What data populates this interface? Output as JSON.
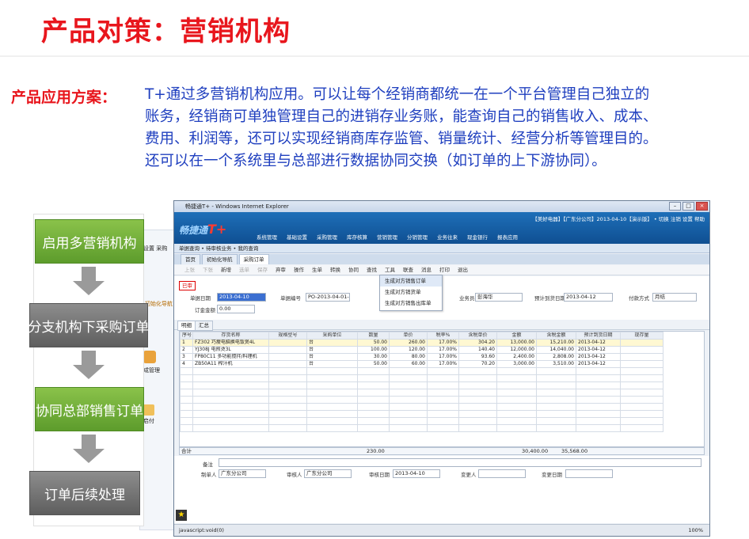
{
  "slide": {
    "title": "产品对策：营销机构",
    "solution_label": "产品应用方案：",
    "solution_lines": [
      "T+通过多营销机构应用。可以让每个经销商都统一在一个平台管理自己独立的",
      "账务，经销商可单独管理自己的进销存业务账，能查询自己的销售收入、成本、",
      "费用、利润等，还可以实现经销商库存监管、销量统计、经营分析等管理目的。",
      "还可以在一个系统里与总部进行数据协同交换（如订单的上下游协同）。"
    ]
  },
  "flow": {
    "steps": [
      "启用多营销机构",
      "分支机构下采购订单",
      "协同总部销售订单",
      "订单后续处理"
    ]
  },
  "bg_fragments": {
    "nav1": "成管理",
    "nav2": "启付",
    "nav3": "初始化导航",
    "nav4": "设置  采购"
  },
  "window": {
    "title": "畅捷通T+ - Windows Internet Explorer",
    "logo_text": "畅捷通",
    "logo_mark": "T+",
    "top_info": "【美好电器】【广东分公司】2013-04-10【演示版】 • 切换  注销  设置  帮助",
    "menu": [
      "系统管理",
      "基础设置",
      "采购管理",
      "库存核算",
      "营销管理",
      "分销管理",
      "业务往来",
      "现金银行",
      "报表应用"
    ],
    "subbar": "单据查询 • 待审核业务 • 我的查询",
    "tabs": [
      "首页",
      "初始化导航",
      "采购订单"
    ],
    "toolbar": [
      {
        "label": "上张",
        "disabled": true
      },
      {
        "label": "下张",
        "disabled": true
      },
      {
        "label": "新增",
        "disabled": false
      },
      {
        "label": "选单",
        "disabled": true
      },
      {
        "label": "保存",
        "disabled": true
      },
      {
        "label": "弃审",
        "disabled": false
      },
      {
        "label": "操作",
        "disabled": false
      },
      {
        "label": "生单",
        "disabled": false
      },
      {
        "label": "转换",
        "disabled": false
      },
      {
        "label": "协同",
        "disabled": false
      },
      {
        "label": "查找",
        "disabled": false
      },
      {
        "label": "工具",
        "disabled": false
      },
      {
        "label": "联查",
        "disabled": false
      },
      {
        "label": "消息",
        "disabled": false
      },
      {
        "label": "打印",
        "disabled": false
      },
      {
        "label": "退出",
        "disabled": false
      }
    ],
    "dropdown": [
      "生成对方销售订单",
      "生成对方销货单",
      "生成对方销售出库单"
    ],
    "form": {
      "stamp": "已审",
      "date_label": "单据日期",
      "date_value": "2013-04-10",
      "code_label": "单据编号",
      "code_value": "PO-2013-04-01-00…",
      "salesman_label": "业务员",
      "salesman_value": "彭海华",
      "arrival_label": "预计到货日期",
      "arrival_value": "2013-04-12",
      "pay_label": "付款方式",
      "pay_value": "月结",
      "deposit_label": "订金金额",
      "deposit_value": "0.00"
    },
    "subtabs": [
      "明细",
      "汇总"
    ],
    "grid": {
      "headers": [
        "序号",
        "存货名称",
        "规格型号",
        "采购单位",
        "数量",
        "单价",
        "税率%",
        "含税单价",
        "金额",
        "含税金额",
        "预计到货日期",
        "现存量"
      ],
      "rows": [
        [
          "1",
          "FZ302 巧瘦电脑换电饭煲4L",
          "",
          "台",
          "50.00",
          "260.00",
          "17.00%",
          "304.20",
          "13,000.00",
          "15,210.00",
          "2013-04-12",
          ""
        ],
        [
          "2",
          "YJ308J 电煎烫3L",
          "",
          "台",
          "100.00",
          "120.00",
          "17.00%",
          "140.40",
          "12,000.00",
          "14,040.00",
          "2013-04-12",
          ""
        ],
        [
          "3",
          "FP80C11 多功能搅拌/料理机",
          "",
          "台",
          "30.00",
          "80.00",
          "17.00%",
          "93.60",
          "2,400.00",
          "2,808.00",
          "2013-04-12",
          ""
        ],
        [
          "4",
          "ZB50A11 榨汁机",
          "",
          "台",
          "50.00",
          "60.00",
          "17.00%",
          "70.20",
          "3,000.00",
          "3,510.00",
          "2013-04-12",
          ""
        ]
      ],
      "total_label": "合计",
      "total_qty": "230.00",
      "total_amount": "30,400.00",
      "total_tax_amount": "35,568.00"
    },
    "footer": {
      "remark_label": "备注",
      "maker_label": "制单人",
      "maker_value": "广东分公司",
      "auditor_label": "审核人",
      "auditor_value": "广东分公司",
      "audit_date_label": "审核日期",
      "audit_date_value": "2013-04-10",
      "change_label": "变更人",
      "change_date_label": "变更日期"
    },
    "status": "javascript:void(0)",
    "zoom": "100%"
  }
}
